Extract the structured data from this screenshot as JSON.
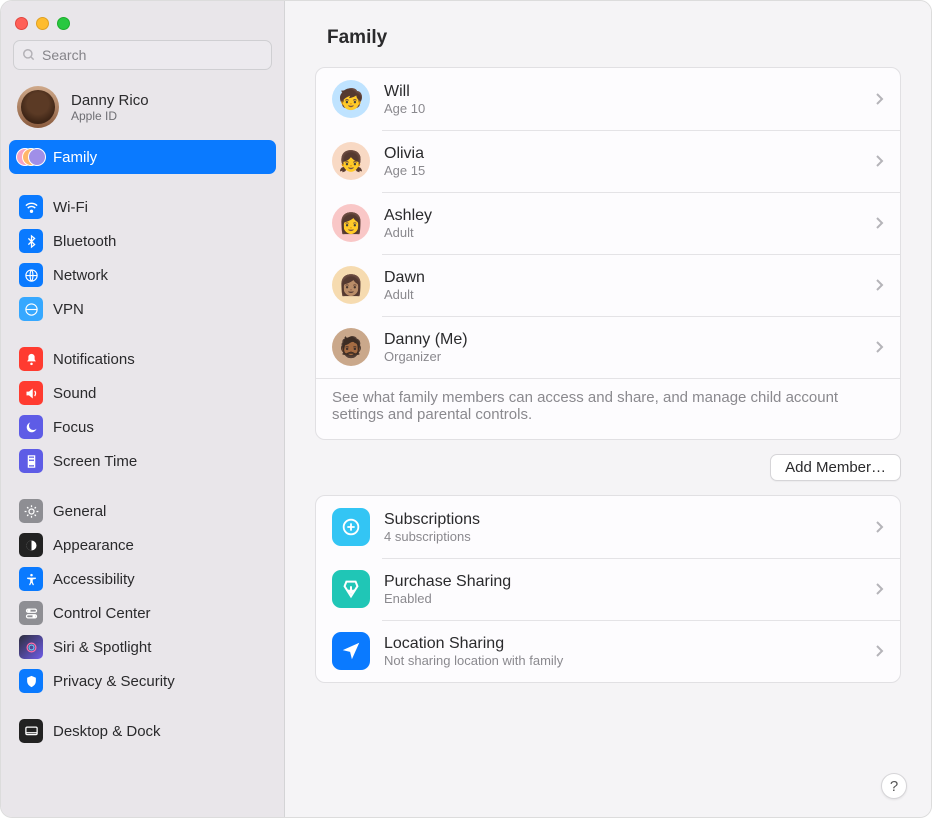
{
  "search": {
    "placeholder": "Search"
  },
  "user": {
    "name": "Danny Rico",
    "sub": "Apple ID"
  },
  "sidebar": {
    "family_label": "Family",
    "wifi": "Wi-Fi",
    "bluetooth": "Bluetooth",
    "network": "Network",
    "vpn": "VPN",
    "notifications": "Notifications",
    "sound": "Sound",
    "focus": "Focus",
    "screen_time": "Screen Time",
    "general": "General",
    "appearance": "Appearance",
    "accessibility": "Accessibility",
    "control_center": "Control Center",
    "siri": "Siri & Spotlight",
    "privacy": "Privacy & Security",
    "desktop_dock": "Desktop & Dock"
  },
  "page": {
    "title": "Family"
  },
  "members": [
    {
      "name": "Will",
      "sub": "Age 10"
    },
    {
      "name": "Olivia",
      "sub": "Age 15"
    },
    {
      "name": "Ashley",
      "sub": "Adult"
    },
    {
      "name": "Dawn",
      "sub": "Adult"
    },
    {
      "name": "Danny (Me)",
      "sub": "Organizer"
    }
  ],
  "members_note": "See what family members can access and share, and manage child account settings and parental controls.",
  "add_member_label": "Add Member…",
  "features": [
    {
      "title": "Subscriptions",
      "sub": "4 subscriptions"
    },
    {
      "title": "Purchase Sharing",
      "sub": "Enabled"
    },
    {
      "title": "Location Sharing",
      "sub": "Not sharing location with family"
    }
  ],
  "avatars": {
    "will": "#bfe3ff",
    "olivia": "#f8d9c4",
    "ashley": "#f9c7c7",
    "dawn": "#f6dbb0",
    "danny": "#caa88b"
  },
  "help_label": "?"
}
